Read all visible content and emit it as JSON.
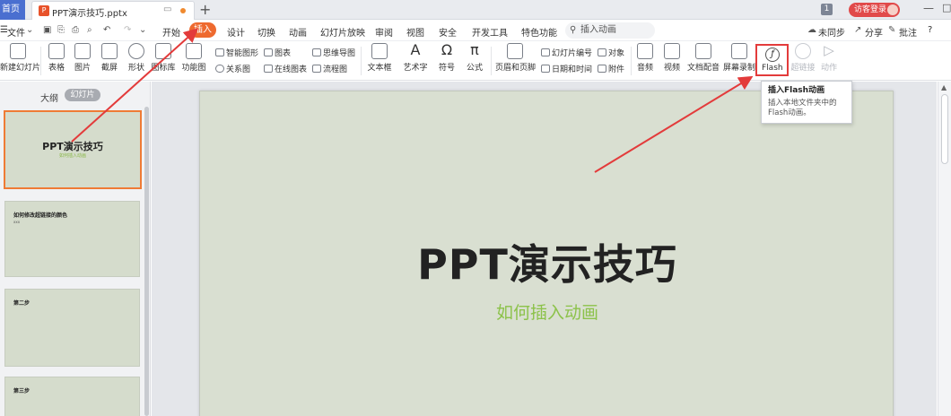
{
  "tabbar": {
    "home_label": "首页",
    "doc_icon": "P",
    "doc_name": "PPT演示技巧.pptx",
    "new_tab": "+",
    "badge": "1",
    "guest_label": "访客登录",
    "win_min": "—",
    "win_restore": "□"
  },
  "menu": {
    "file": "文件",
    "items": [
      "开始",
      "插入",
      "设计",
      "切换",
      "动画",
      "幻灯片放映",
      "审阅",
      "视图",
      "安全",
      "开发工具",
      "特色功能"
    ],
    "active": "插入",
    "search_placeholder": "插入动画",
    "right": {
      "sync": "未同步",
      "share": "分享",
      "comment": "批注",
      "help": "?"
    }
  },
  "ribbon": {
    "new_slide": "新建幻灯片",
    "table": "表格",
    "picture": "图片",
    "screenshot": "截屏",
    "shape": "形状",
    "icon_lib": "图标库",
    "func_chart": "功能图",
    "smart_art": "智能图形",
    "chart": "图表",
    "relation": "关系图",
    "online_chart": "在线图表",
    "mindmap": "思维导图",
    "flowchart": "流程图",
    "textbox": "文本框",
    "art_text": "艺术字",
    "symbol": "符号",
    "formula": "公式",
    "header_footer": "页眉和页脚",
    "slide_number": "幻灯片编号",
    "object": "对象",
    "datetime": "日期和时间",
    "attachment": "附件",
    "audio": "音频",
    "video": "视频",
    "doc_dub": "文档配音",
    "screen_rec": "屏幕录制",
    "flash": "Flash",
    "hyperlink": "超链接",
    "action": "动作"
  },
  "tooltip": {
    "title": "插入Flash动画",
    "desc": "插入本地文件夹中的Flash动画。"
  },
  "leftpane": {
    "outline_tab": "大纲",
    "slides_tab": "幻灯片",
    "thumbs": [
      {
        "title": "PPT演示技巧",
        "sub": "如何插入动画"
      },
      {
        "title": "如何修改超链接的颜色",
        "sub": "xxx"
      },
      {
        "title": "第二步",
        "sub": ""
      },
      {
        "title": "第三步",
        "sub": ""
      }
    ]
  },
  "slide": {
    "title": "PPT演示技巧",
    "subtitle": "如何插入动画",
    "subtitle_color": "#8cc24a",
    "background": "#d9dfd1"
  },
  "colors": {
    "accent": "#ee6a2f",
    "highlight_box": "#e33b3b",
    "arrow": "#e33b3b"
  }
}
